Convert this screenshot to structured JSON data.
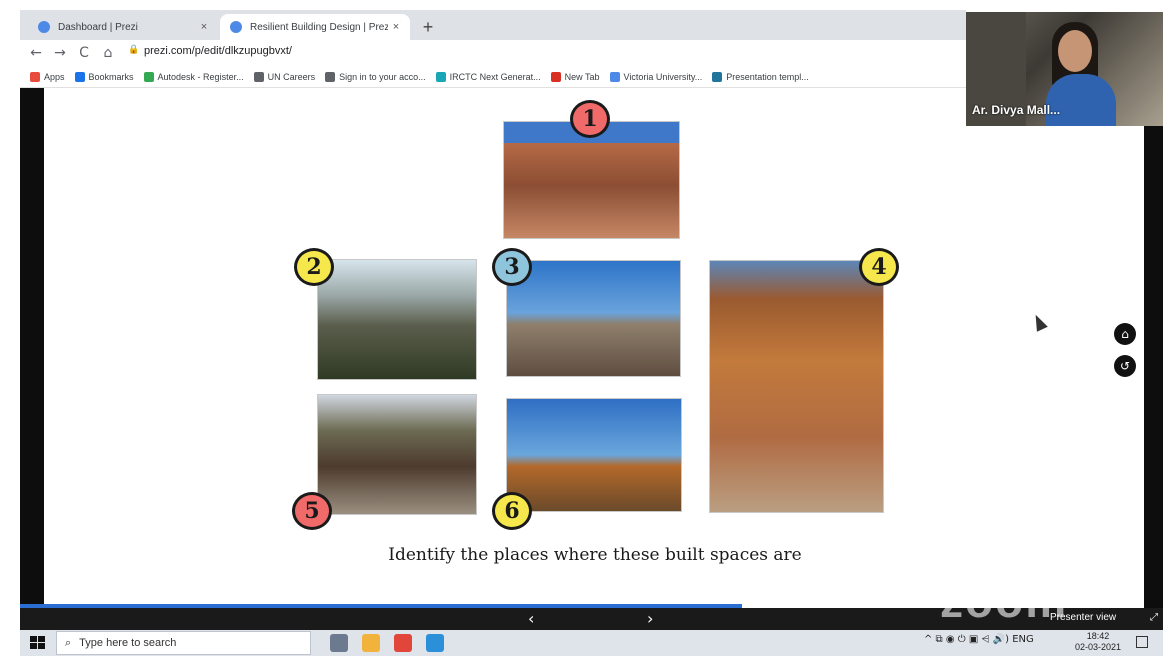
{
  "browser": {
    "tabs": [
      {
        "title": "Dashboard | Prezi",
        "close": "×"
      },
      {
        "title": "Resilient Building Design | Prezi",
        "close": "×"
      }
    ],
    "new_tab": "+",
    "nav": {
      "back": "←",
      "forward": "→",
      "reload": "C",
      "home": "⌂"
    },
    "url": "prezi.com/p/edit/dlkzupugbvxt/",
    "bookmarks": [
      {
        "label": "Apps",
        "color": "#e84b3c"
      },
      {
        "label": "Bookmarks",
        "color": "#1a73e8"
      },
      {
        "label": "Autodesk - Register...",
        "color": "#34a853"
      },
      {
        "label": "UN Careers",
        "color": "#5f6368"
      },
      {
        "label": "Sign in to your acco...",
        "color": "#5f6368"
      },
      {
        "label": "IRCTC Next Generat...",
        "color": "#1aa6b7"
      },
      {
        "label": "New Tab",
        "color": "#d93025"
      },
      {
        "label": "Victoria University...",
        "color": "#4d8ae8"
      },
      {
        "label": "Presentation templ...",
        "color": "#21759b"
      }
    ]
  },
  "video": {
    "speaker": "Ar. Divya Mall..."
  },
  "slide": {
    "badges": [
      "1",
      "2",
      "3",
      "4",
      "5",
      "6"
    ],
    "caption": "Identify the places where these built spaces are"
  },
  "controls": {
    "home_icon": "⌂",
    "back_icon": "↺",
    "prev": "‹",
    "next": "›",
    "zoom_watermark": "zoom",
    "presenter_view": "Presenter view",
    "expand": "⤢"
  },
  "taskbar": {
    "search_placeholder": "Type here to search",
    "search_icon": "⌕",
    "tray": "^  ⧉  ◉  ⏻  ▣  ⩤  🔊)  ENG",
    "time": "18:42",
    "date": "02-03-2021",
    "apps": [
      {
        "name": "task-view",
        "color": "#6b7a8f"
      },
      {
        "name": "file-explorer",
        "color": "#f2b33d"
      },
      {
        "name": "chrome",
        "color": "#e0463a"
      },
      {
        "name": "photos",
        "color": "#2b8fd9"
      }
    ]
  }
}
